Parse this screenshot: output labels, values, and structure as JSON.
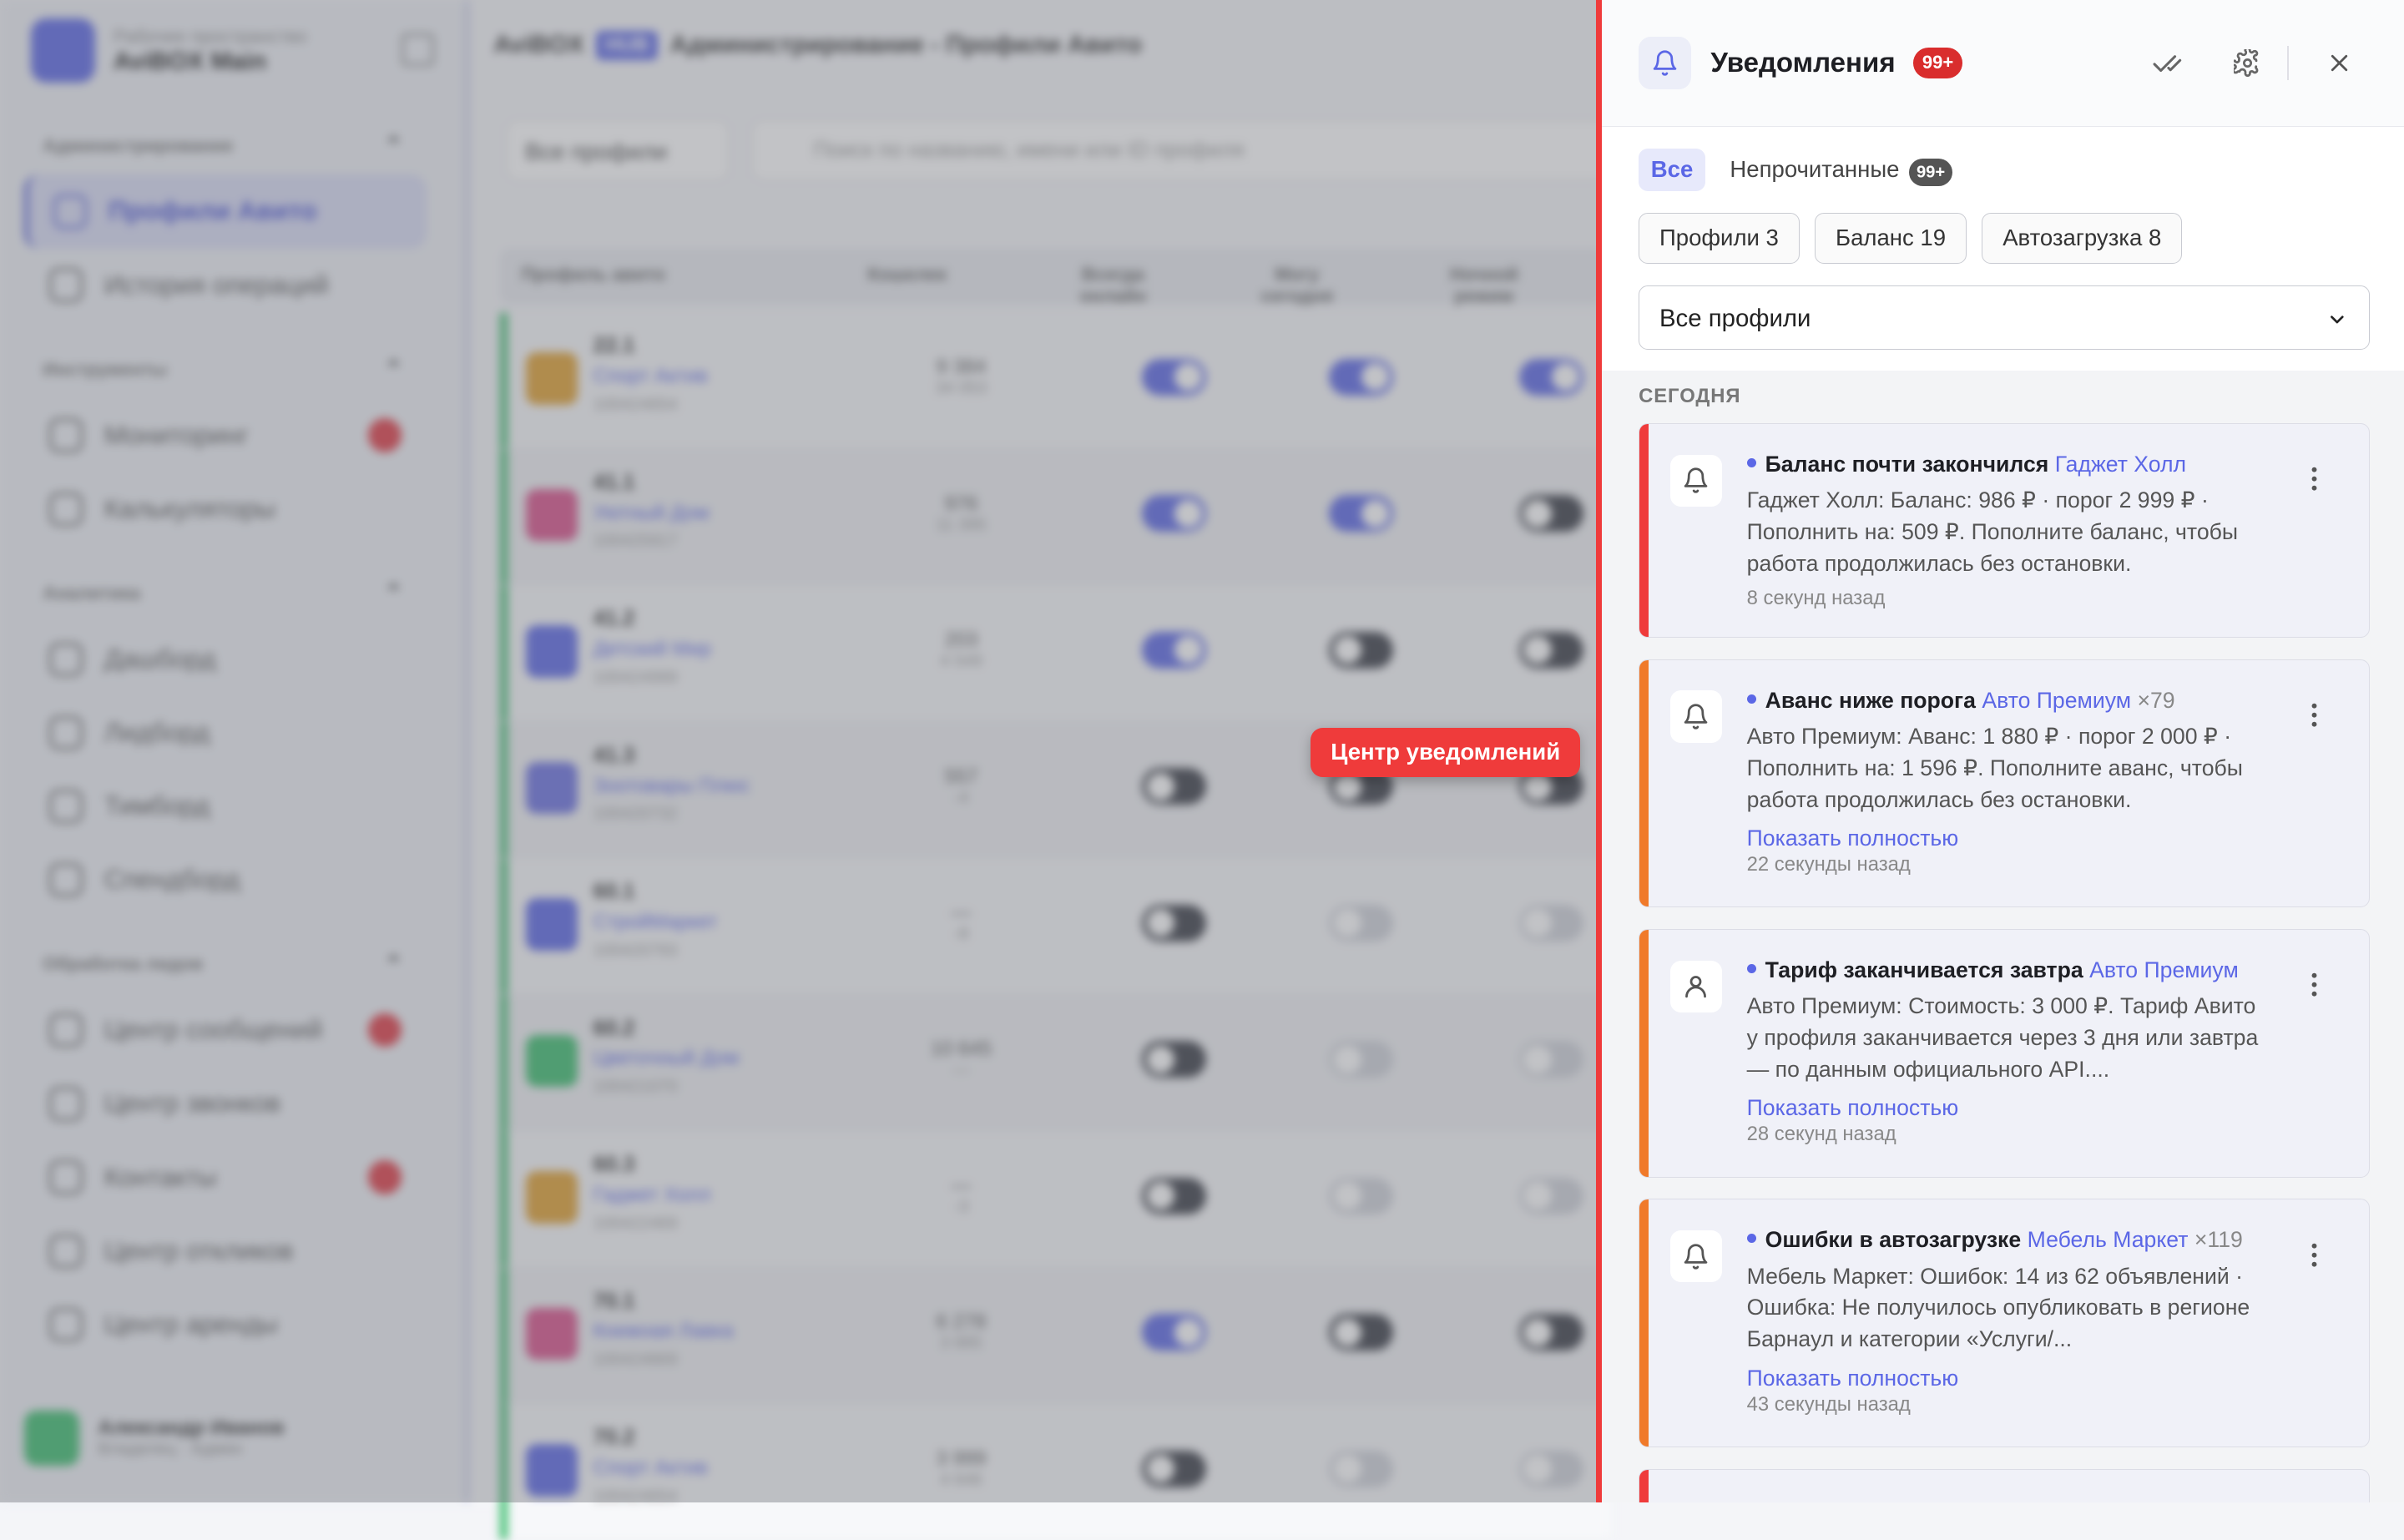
{
  "background": {
    "workspace": {
      "subtitle": "Рабочее пространство",
      "name": "AviBOX Main"
    },
    "sections": [
      {
        "label": "Администрирование",
        "items": [
          {
            "label": "Профили Авито",
            "active": true
          },
          {
            "label": "История операций"
          }
        ]
      },
      {
        "label": "Инструменты",
        "items": [
          {
            "label": "Мониторинг",
            "badge": true
          },
          {
            "label": "Калькуляторы"
          }
        ]
      },
      {
        "label": "Аналитика",
        "items": [
          {
            "label": "Дашборд"
          },
          {
            "label": "Лидборд"
          },
          {
            "label": "Тимборд"
          },
          {
            "label": "Спендборд"
          }
        ]
      },
      {
        "label": "Обработка лидов",
        "items": [
          {
            "label": "Центр сообщений",
            "badge": true
          },
          {
            "label": "Центр звонков"
          },
          {
            "label": "Контакты",
            "badge": true
          },
          {
            "label": "Центр откликов"
          },
          {
            "label": "Центр аренды"
          }
        ]
      }
    ],
    "user": {
      "name": "Александр Иванов",
      "role": "Владелец",
      "tag": "Админ"
    },
    "topbar": {
      "brand": "AviBOX",
      "hub": "HUB",
      "title": "Администрирование - Профили Авито"
    },
    "filter": "Все профили",
    "search_placeholder": "Поиск по названию, имени или ID профиля",
    "columns": [
      "Профиль авито",
      "Кошелек",
      "Всегда онлайн",
      "Могу сегодня",
      "Ночной режим"
    ],
    "rows": [
      {
        "code": "22.1",
        "name": "Спорт Актив",
        "id": "100424654",
        "wallet": "9 384",
        "sub": "34 053",
        "color": "#e0a030",
        "t": [
          "on",
          "on",
          "on"
        ]
      },
      {
        "code": "41.1",
        "name": "Уютный Дом",
        "id": "100425917",
        "wallet": "976",
        "sub": "11 395",
        "color": "#d9508a",
        "t": [
          "on",
          "on",
          "dark"
        ]
      },
      {
        "code": "41.2",
        "name": "Детский Мир",
        "id": "100424999",
        "wallet": "203",
        "sub": "4 549",
        "color": "#5b67e6",
        "t": [
          "on",
          "dark",
          "dark"
        ]
      },
      {
        "code": "41.3",
        "name": "Зоотовары Плюс",
        "id": "100420732",
        "wallet": "557",
        "sub": "-4",
        "color": "#6a70e0",
        "t": [
          "dark",
          "dark",
          "dark"
        ]
      },
      {
        "code": "60.1",
        "name": "СтройМаркет",
        "id": "100420793",
        "wallet": "—",
        "sub": "-8",
        "color": "#5b67e6",
        "t": [
          "dark",
          "off",
          "off"
        ]
      },
      {
        "code": "60.2",
        "name": "Цветочный Дом",
        "id": "100421070",
        "wallet": "10 645",
        "sub": "—",
        "color": "#3cbe6e",
        "t": [
          "dark",
          "off",
          "off"
        ]
      },
      {
        "code": "60.3",
        "name": "Гаджет Холл",
        "id": "100422469",
        "wallet": "—",
        "sub": "-3",
        "color": "#e0a030",
        "t": [
          "dark",
          "off",
          "off"
        ]
      },
      {
        "code": "70.1",
        "name": "Книжная Лавка",
        "id": "100424669",
        "wallet": "6 278",
        "sub": "3 885",
        "color": "#d9508a",
        "t": [
          "on",
          "dark",
          "dark"
        ]
      },
      {
        "code": "70.2",
        "name": "Спорт Актив",
        "id": "100424654",
        "wallet": "3 999",
        "sub": "4 646",
        "color": "#5b67e6",
        "t": [
          "dark",
          "off",
          "off"
        ]
      }
    ]
  },
  "tooltip": "Центр уведомлений",
  "panel": {
    "title": "Уведомления",
    "count": "99+",
    "tabs": [
      {
        "label": "Все",
        "active": true
      },
      {
        "label": "Непрочитанные",
        "count": "99+"
      }
    ],
    "chips": [
      "Профили 3",
      "Баланс 19",
      "Автозагрузка 8"
    ],
    "profile_select": "Все профили",
    "day_label": "СЕГОДНЯ",
    "cards": [
      {
        "title": "Баланс почти закончился",
        "profile": "Гаджет Холл",
        "multiplier": "",
        "body": "Гаджет Холл: Баланс: 986 ₽ · порог 2 999 ₽ · Пополнить на: 509 ₽. Пополните баланс, чтобы работа продолжилась без остановки.",
        "more": "",
        "time": "8 секунд назад",
        "accent": "#ef3b3b",
        "icon": "bell"
      },
      {
        "title": "Аванс ниже порога",
        "profile": "Авто Премиум",
        "multiplier": "×79",
        "body": "Авто Премиум: Аванс: 1 880 ₽ · порог 2 000 ₽ · Пополнить на: 1 596 ₽. Пополните аванс, чтобы работа продолжилась без остановки.",
        "more": "Показать полностью",
        "time": "22 секунды назад",
        "accent": "#f07a2a",
        "icon": "bell"
      },
      {
        "title": "Тариф заканчивается завтра",
        "profile": "Авто Премиум",
        "multiplier": "",
        "body": "Авто Премиум: Стоимость: 3 000 ₽. Тариф Авито у профиля заканчивается через 3 дня или завтра — по данным официального API....",
        "more": "Показать полностью",
        "time": "28 секунд назад",
        "accent": "#f07a2a",
        "icon": "user"
      },
      {
        "title": "Ошибки в автозагрузке",
        "profile": "Мебель Маркет",
        "multiplier": "×119",
        "body": "Мебель Маркет: Ошибок: 14 из 62 объявлений · Ошибка: Не получилось опубликовать в регионе Барнаул и категории «Услуги/...",
        "more": "Показать полностью",
        "time": "43 секунды назад",
        "accent": "#f07a2a",
        "icon": "bell"
      }
    ]
  }
}
